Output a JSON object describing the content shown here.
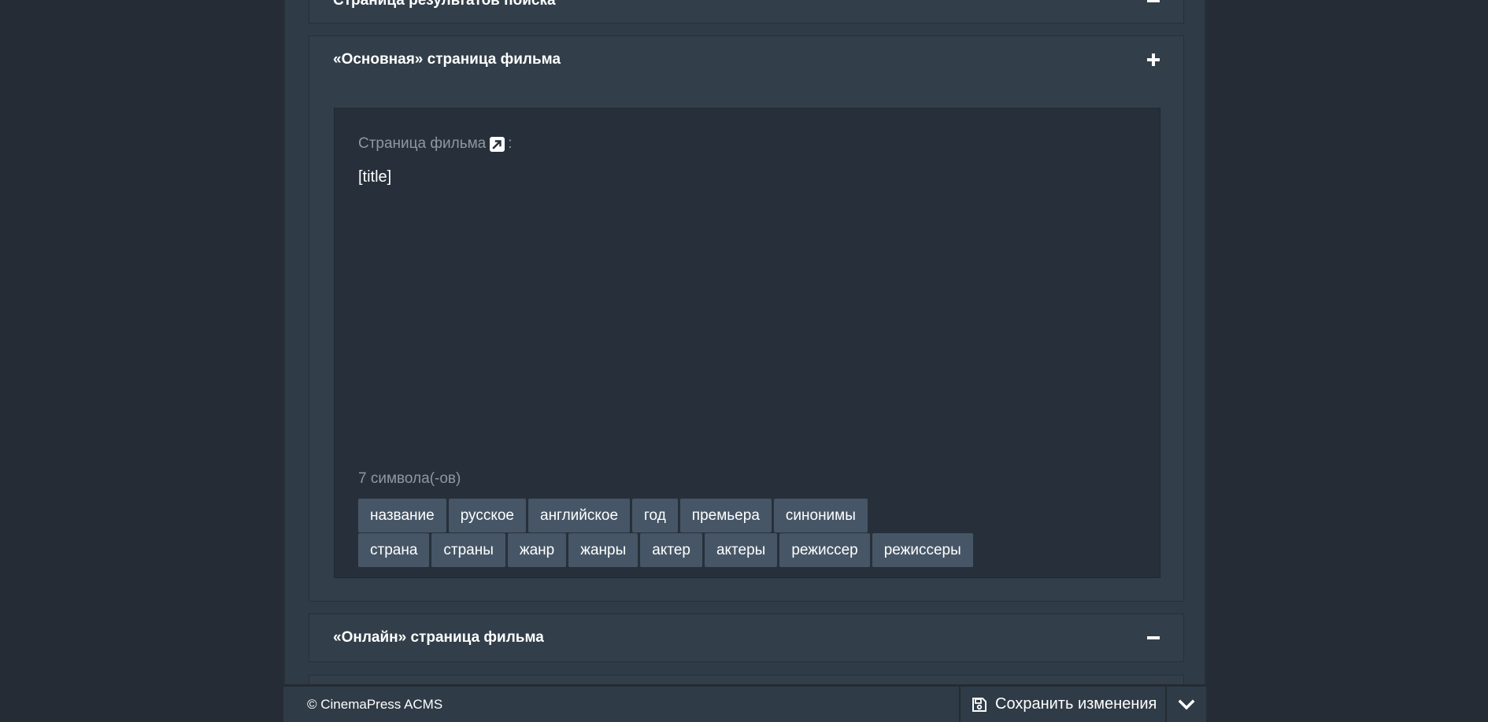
{
  "panels": {
    "search_results": {
      "title": "Страница результатов поиска",
      "state_icon": "minus-icon"
    },
    "main_movie": {
      "title": "«Основная» страница фильма",
      "state_icon": "plus-icon",
      "field_label": "Страница фильма",
      "field_label_suffix": ":",
      "field_value": "[title]",
      "char_count": "7 символа(-ов)",
      "tags_row1": [
        "название",
        "русское",
        "английское",
        "год",
        "премьера",
        "синонимы"
      ],
      "tags_row2": [
        "страна",
        "страны",
        "жанр",
        "жанры",
        "актер",
        "актеры",
        "режиссер",
        "режиссеры"
      ]
    },
    "online_movie": {
      "title": "«Онлайн» страница фильма",
      "state_icon": "minus-icon"
    }
  },
  "footer": {
    "copyright": "© CinemaPress ACMS",
    "save_label": "Сохранить изменения",
    "save_icon": "floppy-disk-icon",
    "scroll_icon": "chevron-down-icon"
  },
  "colors": {
    "background": "#252c35",
    "column": "#2f3b46",
    "panel": "#323f4a",
    "editor": "#27303a",
    "tag": "#465666",
    "text": "#ffffff",
    "muted": "#8f979f"
  }
}
